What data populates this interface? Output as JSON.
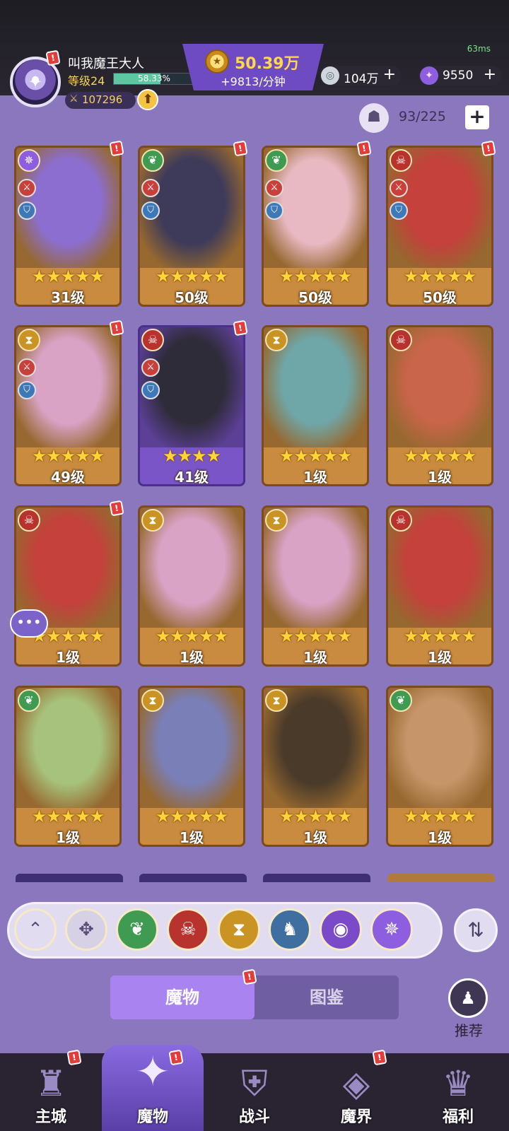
{
  "status": {
    "ping": "63ms"
  },
  "player": {
    "name": "叫我魔王大人",
    "level": "等级24",
    "xp_text": "58.33%",
    "xp_progress": 0.5833,
    "power": "107296"
  },
  "currency": {
    "gold": "50.39万",
    "gold_rate": "+9813/分钟",
    "silver": "104万",
    "crystal": "9550",
    "plus": "+"
  },
  "inventory": {
    "count": "93/225",
    "plus": "+"
  },
  "alert_mark": "!",
  "cards": [
    {
      "level": "31级",
      "stars": "★★★★★",
      "faction": "purple-swirl",
      "color": "#8c6ed0"
    },
    {
      "level": "50级",
      "stars": "★★★★★",
      "faction": "green-leaf",
      "color": "#3d3a5a"
    },
    {
      "level": "50级",
      "stars": "★★★★★",
      "faction": "green-leaf",
      "color": "#e8b9c2"
    },
    {
      "level": "50级",
      "stars": "★★★★★",
      "faction": "red-skull",
      "color": "#c4413c"
    },
    {
      "level": "49级",
      "stars": "★★★★★",
      "faction": "gold-hourglass",
      "color": "#d9a3c6"
    },
    {
      "level": "41级",
      "stars": "★★★★",
      "faction": "red-skull",
      "color": "#2f2c3a"
    },
    {
      "level": "1级",
      "stars": "★★★★★",
      "faction": "gold-hourglass",
      "color": "#6fa7a9"
    },
    {
      "level": "1级",
      "stars": "★★★★★",
      "faction": "red-skull",
      "color": "#c8654a"
    },
    {
      "level": "1级",
      "stars": "★★★★★",
      "faction": "red-skull",
      "color": "#c4413c"
    },
    {
      "level": "1级",
      "stars": "★★★★★",
      "faction": "gold-hourglass",
      "color": "#d9a3c6"
    },
    {
      "level": "1级",
      "stars": "★★★★★",
      "faction": "gold-hourglass",
      "color": "#d9a3c6"
    },
    {
      "level": "1级",
      "stars": "★★★★★",
      "faction": "red-skull",
      "color": "#c4413c"
    },
    {
      "level": "1级",
      "stars": "★★★★★",
      "faction": "green-leaf",
      "color": "#a7c27c"
    },
    {
      "level": "1级",
      "stars": "★★★★★",
      "faction": "gold-hourglass",
      "color": "#7a7fb8"
    },
    {
      "level": "1级",
      "stars": "★★★★★",
      "faction": "gold-hourglass",
      "color": "#4a3a2a"
    },
    {
      "level": "1级",
      "stars": "★★★★★",
      "faction": "green-leaf",
      "color": "#c7956a"
    }
  ],
  "filters": [
    {
      "name": "collapse",
      "icon": "⌃"
    },
    {
      "name": "all",
      "icon": "✥"
    },
    {
      "name": "leaf",
      "icon": "❦"
    },
    {
      "name": "skull",
      "icon": "☠"
    },
    {
      "name": "hourglass",
      "icon": "⧗"
    },
    {
      "name": "dragon",
      "icon": "♞"
    },
    {
      "name": "eye",
      "icon": "◉"
    },
    {
      "name": "swirl",
      "icon": "✵"
    }
  ],
  "tabs": {
    "monsters": "魔物",
    "codex": "图鉴"
  },
  "recommend": "推荐",
  "nav": [
    {
      "label": "主城",
      "icon": "♜"
    },
    {
      "label": "魔物",
      "icon": "✦"
    },
    {
      "label": "战斗",
      "icon": "⛨"
    },
    {
      "label": "魔界",
      "icon": "◈"
    },
    {
      "label": "福利",
      "icon": "♛"
    }
  ]
}
